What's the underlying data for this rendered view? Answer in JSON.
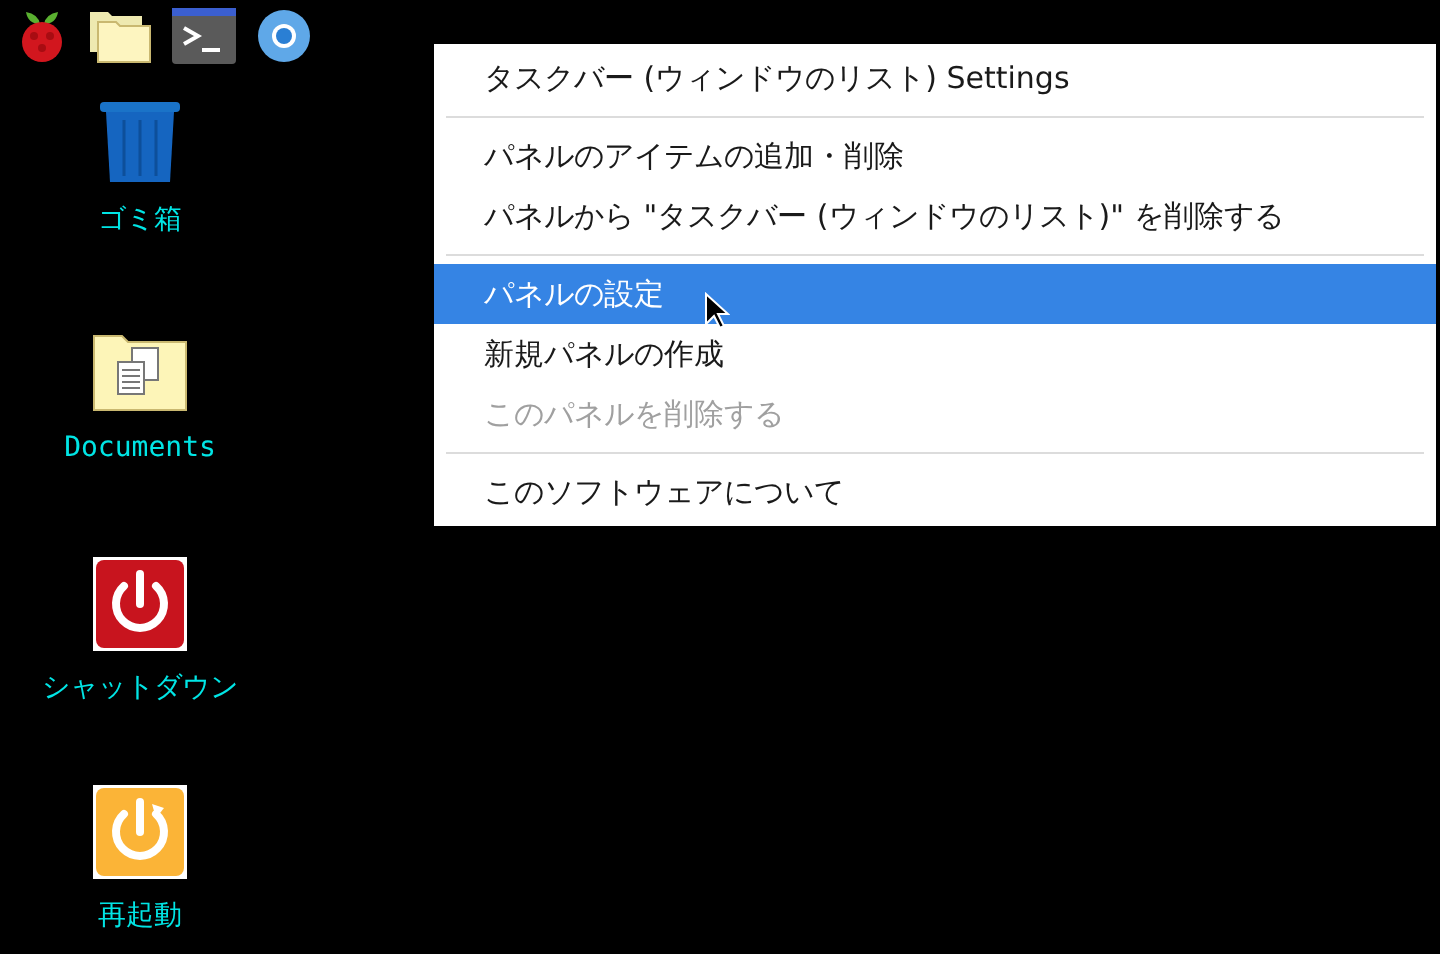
{
  "desktop_icons": [
    {
      "kind": "trash",
      "label": "ゴミ箱"
    },
    {
      "kind": "folder",
      "label": "Documents"
    },
    {
      "kind": "shutdown",
      "label": "シャットダウン"
    },
    {
      "kind": "reboot",
      "label": "再起動"
    }
  ],
  "menu": {
    "items": [
      {
        "kind": "item",
        "label": "タスクバー (ウィンドウのリスト) Settings",
        "selected": false,
        "disabled": false
      },
      {
        "kind": "separator"
      },
      {
        "kind": "item",
        "label": "パネルのアイテムの追加・削除",
        "selected": false,
        "disabled": false
      },
      {
        "kind": "item",
        "label": "パネルから \"タスクバー (ウィンドウのリスト)\" を削除する",
        "selected": false,
        "disabled": false
      },
      {
        "kind": "separator"
      },
      {
        "kind": "item",
        "label": "パネルの設定",
        "selected": true,
        "disabled": false
      },
      {
        "kind": "item",
        "label": "新規パネルの作成",
        "selected": false,
        "disabled": false
      },
      {
        "kind": "item",
        "label": "このパネルを削除する",
        "selected": false,
        "disabled": true
      },
      {
        "kind": "separator"
      },
      {
        "kind": "item",
        "label": "このソフトウェアについて",
        "selected": false,
        "disabled": false
      }
    ]
  }
}
